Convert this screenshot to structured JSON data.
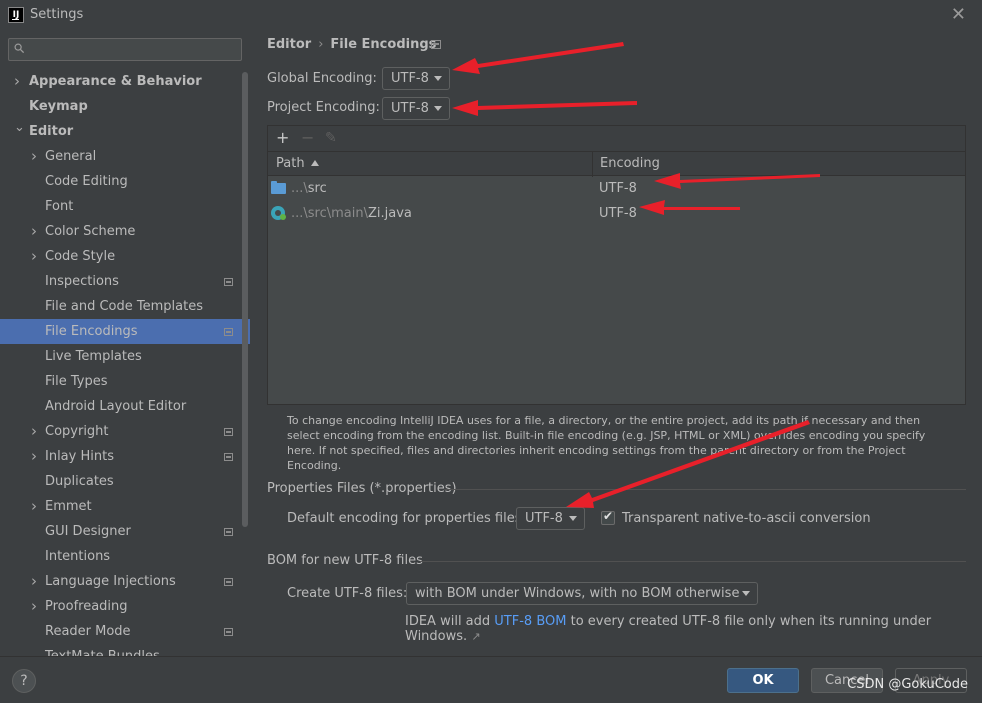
{
  "window": {
    "title": "Settings",
    "app_icon": "IJ",
    "close_icon": "close-icon"
  },
  "sidebar": {
    "search": {
      "value": "",
      "placeholder": ""
    },
    "items": [
      {
        "label": "Appearance & Behavior",
        "level": 0,
        "expandable": true,
        "expanded": false,
        "bold": true,
        "badge": false,
        "selected": false
      },
      {
        "label": "Keymap",
        "level": 0,
        "expandable": false,
        "bold": true,
        "badge": false,
        "selected": false
      },
      {
        "label": "Editor",
        "level": 0,
        "expandable": true,
        "expanded": true,
        "bold": true,
        "badge": false,
        "selected": false
      },
      {
        "label": "General",
        "level": 1,
        "expandable": true,
        "expanded": false,
        "bold": false,
        "badge": false,
        "selected": false
      },
      {
        "label": "Code Editing",
        "level": 1,
        "expandable": false,
        "bold": false,
        "badge": false,
        "selected": false
      },
      {
        "label": "Font",
        "level": 1,
        "expandable": false,
        "bold": false,
        "badge": false,
        "selected": false
      },
      {
        "label": "Color Scheme",
        "level": 1,
        "expandable": true,
        "expanded": false,
        "bold": false,
        "badge": false,
        "selected": false
      },
      {
        "label": "Code Style",
        "level": 1,
        "expandable": true,
        "expanded": false,
        "bold": false,
        "badge": false,
        "selected": false
      },
      {
        "label": "Inspections",
        "level": 1,
        "expandable": false,
        "bold": false,
        "badge": true,
        "selected": false
      },
      {
        "label": "File and Code Templates",
        "level": 1,
        "expandable": false,
        "bold": false,
        "badge": false,
        "selected": false
      },
      {
        "label": "File Encodings",
        "level": 1,
        "expandable": false,
        "bold": false,
        "badge": true,
        "selected": true
      },
      {
        "label": "Live Templates",
        "level": 1,
        "expandable": false,
        "bold": false,
        "badge": false,
        "selected": false
      },
      {
        "label": "File Types",
        "level": 1,
        "expandable": false,
        "bold": false,
        "badge": false,
        "selected": false
      },
      {
        "label": "Android Layout Editor",
        "level": 1,
        "expandable": false,
        "bold": false,
        "badge": false,
        "selected": false
      },
      {
        "label": "Copyright",
        "level": 1,
        "expandable": true,
        "expanded": false,
        "bold": false,
        "badge": true,
        "selected": false
      },
      {
        "label": "Inlay Hints",
        "level": 1,
        "expandable": true,
        "expanded": false,
        "bold": false,
        "badge": true,
        "selected": false
      },
      {
        "label": "Duplicates",
        "level": 1,
        "expandable": false,
        "bold": false,
        "badge": false,
        "selected": false
      },
      {
        "label": "Emmet",
        "level": 1,
        "expandable": true,
        "expanded": false,
        "bold": false,
        "badge": false,
        "selected": false
      },
      {
        "label": "GUI Designer",
        "level": 1,
        "expandable": false,
        "bold": false,
        "badge": true,
        "selected": false
      },
      {
        "label": "Intentions",
        "level": 1,
        "expandable": false,
        "bold": false,
        "badge": false,
        "selected": false
      },
      {
        "label": "Language Injections",
        "level": 1,
        "expandable": true,
        "expanded": false,
        "bold": false,
        "badge": true,
        "selected": false
      },
      {
        "label": "Proofreading",
        "level": 1,
        "expandable": true,
        "expanded": false,
        "bold": false,
        "badge": false,
        "selected": false
      },
      {
        "label": "Reader Mode",
        "level": 1,
        "expandable": false,
        "bold": false,
        "badge": true,
        "selected": false
      },
      {
        "label": "TextMate Bundles",
        "level": 1,
        "expandable": false,
        "bold": false,
        "badge": false,
        "selected": false
      }
    ]
  },
  "main": {
    "breadcrumb": {
      "parent": "Editor",
      "separator": "›",
      "current": "File Encodings"
    },
    "global_encoding": {
      "label": "Global Encoding:",
      "value": "UTF-8"
    },
    "project_encoding": {
      "label": "Project Encoding:",
      "value": "UTF-8"
    },
    "toolbar": {
      "add": "+",
      "remove": "−",
      "edit": "✎"
    },
    "table": {
      "headers": {
        "path": "Path",
        "encoding": "Encoding"
      },
      "rows": [
        {
          "icon": "folder-icon",
          "path_prefix": "...\\",
          "path_name": "src",
          "encoding": "UTF-8"
        },
        {
          "icon": "java-class-icon",
          "path_prefix": "...\\src\\main\\",
          "path_name": "Zi.java",
          "encoding": "UTF-8"
        }
      ]
    },
    "help_text": "To change encoding IntelliJ IDEA uses for a file, a directory, or the entire project, add its path if necessary and then select encoding from the encoding list. Built-in file encoding (e.g. JSP, HTML or XML) overrides encoding you specify here. If not specified, files and directories inherit encoding settings from the parent directory or from the Project Encoding.",
    "properties": {
      "section_title": "Properties Files (*.properties)",
      "default_label": "Default encoding for properties files:",
      "default_value": "UTF-8",
      "transparent_label": "Transparent native-to-ascii conversion",
      "transparent_checked": true
    },
    "bom": {
      "section_title": "BOM for new UTF-8 files",
      "create_label": "Create UTF-8 files:",
      "create_value": "with BOM under Windows, with no BOM otherwise",
      "note_prefix": "IDEA will add ",
      "note_link": "UTF-8 BOM",
      "note_suffix": " to every created UTF-8 file only when its running under Windows.",
      "note_arrow": "↗"
    }
  },
  "footer": {
    "help": "?",
    "ok": "OK",
    "cancel": "Cancel",
    "apply": "Apply",
    "watermark": "CSDN @GokuCode"
  },
  "colors": {
    "background": "#3c3f41",
    "selection": "#4b6eaf",
    "ok_button": "#365880",
    "link": "#589df6",
    "annotation_arrow": "#e8202a"
  }
}
